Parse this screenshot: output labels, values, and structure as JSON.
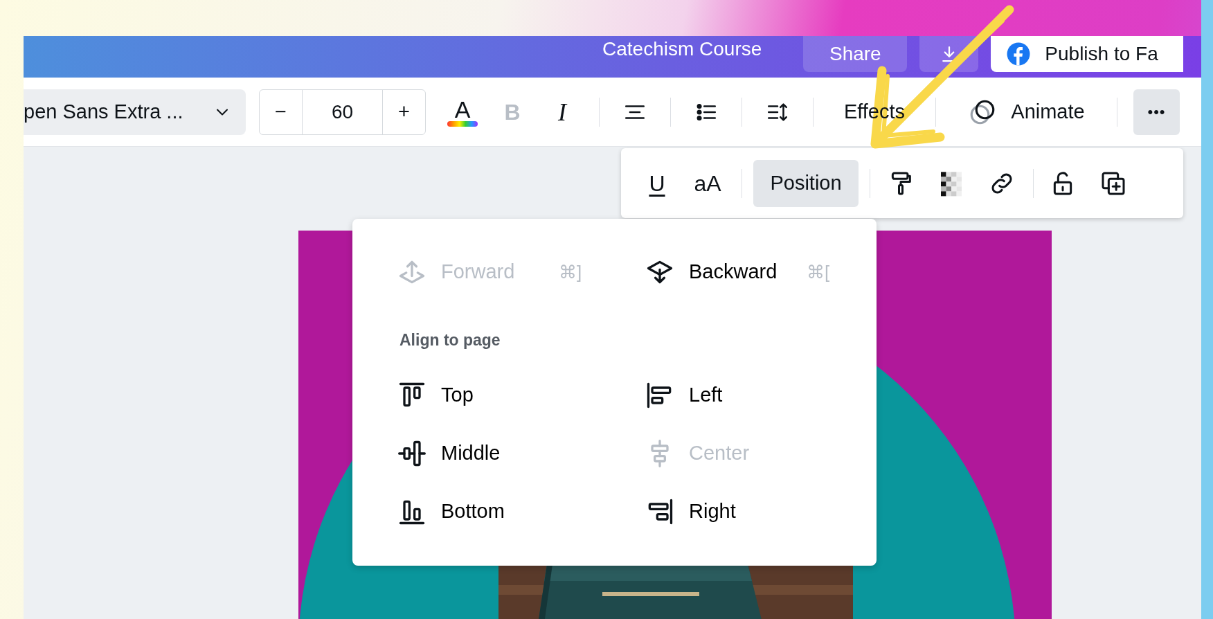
{
  "header": {
    "title": "Catechism Course",
    "share": "Share",
    "publish": "Publish to Fa"
  },
  "toolbar": {
    "font": "pen Sans Extra ...",
    "font_size": {
      "minus": "−",
      "value": "60",
      "plus": "+"
    },
    "text_color": "A",
    "bold": {
      "label": "B",
      "disabled": true
    },
    "italic": {
      "label": "I",
      "disabled": false
    },
    "effects": "Effects",
    "animate": "Animate",
    "more": "•••"
  },
  "subtoolbar": {
    "underline": "U",
    "letter_case": "aA",
    "position": {
      "label": "Position",
      "selected": true
    }
  },
  "menu": {
    "layer": [
      {
        "kind": "forward",
        "label": "Forward",
        "shortcut": "⌘]",
        "disabled": true
      },
      {
        "kind": "backward",
        "label": "Backward",
        "shortcut": "⌘[",
        "disabled": false
      }
    ],
    "heading": "Align to page",
    "align": [
      {
        "kind": "top",
        "label": "Top",
        "disabled": false
      },
      {
        "kind": "left",
        "label": "Left",
        "disabled": false
      },
      {
        "kind": "middle",
        "label": "Middle",
        "disabled": false
      },
      {
        "kind": "center",
        "label": "Center",
        "disabled": true
      },
      {
        "kind": "bottom",
        "label": "Bottom",
        "disabled": false
      },
      {
        "kind": "right",
        "label": "Right",
        "disabled": false
      }
    ]
  }
}
